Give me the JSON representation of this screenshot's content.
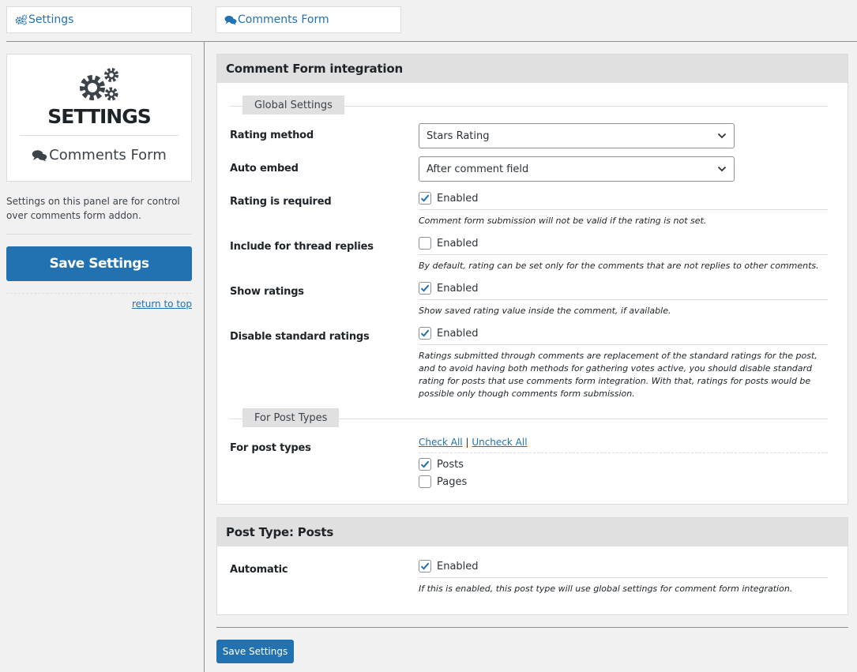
{
  "breadcrumb": {
    "settings": "Settings",
    "comments_form": "Comments Form"
  },
  "sidebar": {
    "title": "SETTINGS",
    "subtitle": "Comments Form",
    "description": "Settings on this panel are for control over comments form addon.",
    "save_label": "Save Settings",
    "return_link": "return to top"
  },
  "main_panel": {
    "title": "Comment Form integration",
    "global_group": "Global Settings",
    "rating_method": {
      "label": "Rating method",
      "value": "Stars Rating"
    },
    "auto_embed": {
      "label": "Auto embed",
      "value": "After comment field"
    },
    "rating_required": {
      "label": "Rating is required",
      "checkbox": "Enabled",
      "checked": true,
      "note": "Comment form submission will not be valid if the rating is not set."
    },
    "thread_replies": {
      "label": "Include for thread replies",
      "checkbox": "Enabled",
      "checked": false,
      "note": "By default, rating can be set only for the comments that are not replies to other comments."
    },
    "show_ratings": {
      "label": "Show ratings",
      "checkbox": "Enabled",
      "checked": true,
      "note": "Show saved rating value inside the comment, if available."
    },
    "disable_standard": {
      "label": "Disable standard ratings",
      "checkbox": "Enabled",
      "checked": true,
      "note": "Ratings submitted through comments are replacement of the standard ratings for the post, and to avoid having both methods for gathering votes active, you should disable standard rating for posts that use comments form integration. With that, ratings for posts would be possible only though comments form submission."
    },
    "post_types_group": "For Post Types",
    "post_types": {
      "label": "For post types",
      "check_all": "Check All",
      "separator": "|",
      "uncheck_all": "Uncheck All",
      "posts": "Posts",
      "posts_checked": true,
      "pages": "Pages",
      "pages_checked": false
    }
  },
  "posts_panel": {
    "title": "Post Type: Posts",
    "automatic": {
      "label": "Automatic",
      "checkbox": "Enabled",
      "checked": true,
      "note": "If this is enabled, this post type will use global settings for comment form integration."
    }
  },
  "bottom_save_label": "Save Settings",
  "colors": {
    "accent": "#2271b1",
    "panel_header": "#e0e0e0",
    "background": "#f1f1f1"
  }
}
